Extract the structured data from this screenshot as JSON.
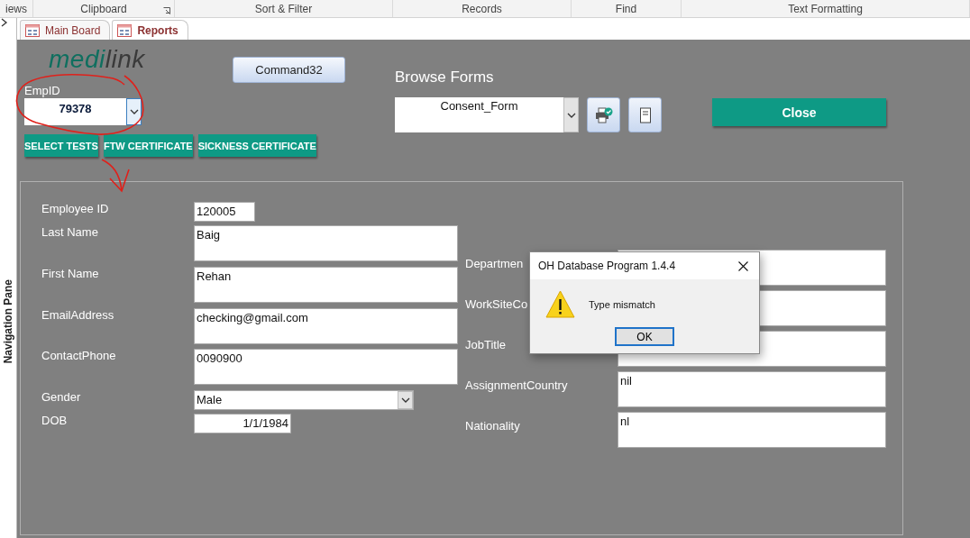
{
  "ribbon_groups": [
    {
      "label": "iews",
      "launcher": false
    },
    {
      "label": "Clipboard",
      "launcher": true
    },
    {
      "label": "Sort & Filter",
      "launcher": false
    },
    {
      "label": "Records",
      "launcher": false
    },
    {
      "label": "Find",
      "launcher": false
    },
    {
      "label": "Text Formatting",
      "launcher": false
    }
  ],
  "nav_pane": {
    "label": "Navigation Pane"
  },
  "tabs": [
    {
      "label": "Main Board",
      "selected": false
    },
    {
      "label": "Reports",
      "selected": true
    }
  ],
  "form": {
    "logo": {
      "primary": "medi",
      "secondary": "link"
    },
    "command_button": "Command32",
    "emp_id": {
      "label": "EmpID",
      "value": "79378"
    },
    "actions": [
      "SELECT TESTS",
      "FTW CERTIFICATE",
      "SICKNESS CERTIFICATE"
    ],
    "browse": {
      "label": "Browse Forms",
      "value": "Consent_Form"
    },
    "close_button": "Close"
  },
  "details": {
    "left": [
      {
        "label": "Employee ID",
        "value": "120005",
        "kind": "short"
      },
      {
        "label": "Last Name",
        "value": "Baig",
        "kind": "text"
      },
      {
        "label": "First Name",
        "value": "Rehan",
        "kind": "text"
      },
      {
        "label": "EmailAddress",
        "value": "checking@gmail.com",
        "kind": "text"
      },
      {
        "label": "ContactPhone",
        "value": "0090900",
        "kind": "text"
      },
      {
        "label": "Gender",
        "value": "Male",
        "kind": "combo"
      },
      {
        "label": "DOB",
        "value": "1/1/1984",
        "kind": "date"
      }
    ],
    "right": [
      {
        "label": "Departmen",
        "kind": "text"
      },
      {
        "label": "WorkSiteCo",
        "kind": "text"
      },
      {
        "label": "JobTitle",
        "kind": "text"
      },
      {
        "label": "AssignmentCountry",
        "value": "nil",
        "kind": "text"
      },
      {
        "label": "Nationality",
        "value": "nl",
        "kind": "text"
      }
    ]
  },
  "dialog": {
    "title": "OH Database Program 1.4.4",
    "message": "Type mismatch",
    "button": "OK"
  }
}
